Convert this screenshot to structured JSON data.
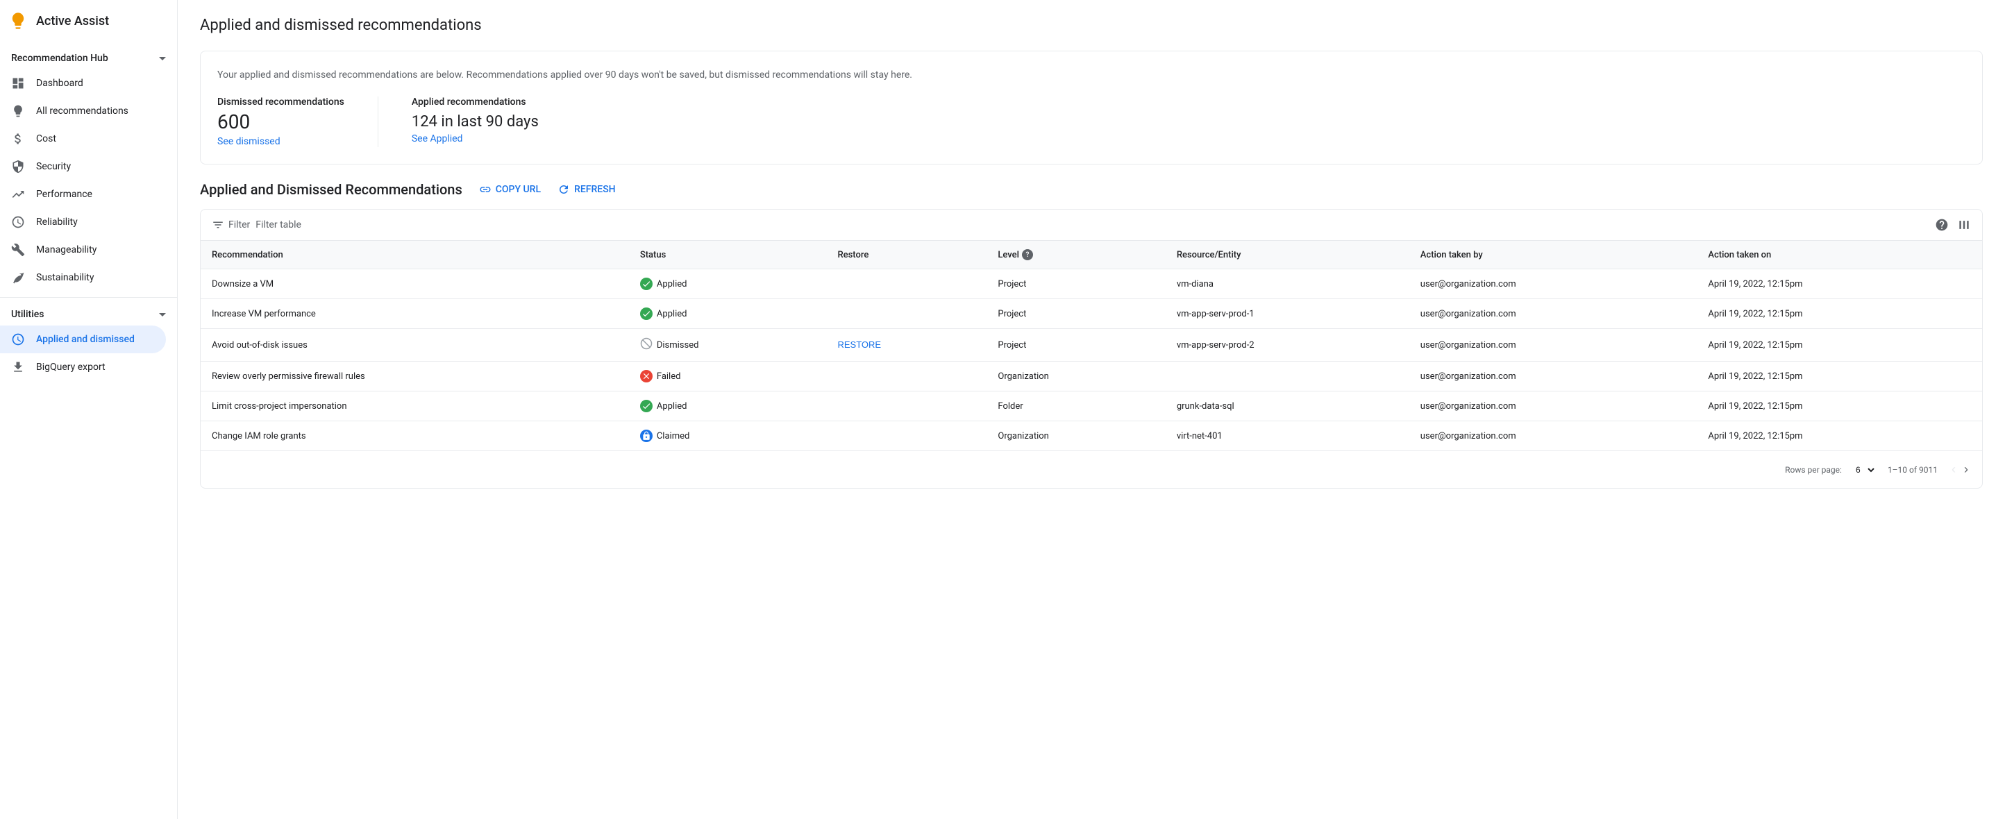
{
  "sidebar": {
    "app_name": "Active Assist",
    "recommendation_hub_label": "Recommendation Hub",
    "items": [
      {
        "id": "dashboard",
        "label": "Dashboard",
        "icon": "dashboard"
      },
      {
        "id": "all-recommendations",
        "label": "All recommendations",
        "icon": "lightbulb"
      },
      {
        "id": "cost",
        "label": "Cost",
        "icon": "dollar"
      },
      {
        "id": "security",
        "label": "Security",
        "icon": "lock"
      },
      {
        "id": "performance",
        "label": "Performance",
        "icon": "trending-up"
      },
      {
        "id": "reliability",
        "label": "Reliability",
        "icon": "clock"
      },
      {
        "id": "manageability",
        "label": "Manageability",
        "icon": "wrench"
      },
      {
        "id": "sustainability",
        "label": "Sustainability",
        "icon": "leaf"
      }
    ],
    "utilities_label": "Utilities",
    "utilities_items": [
      {
        "id": "applied-dismissed",
        "label": "Applied and dismissed",
        "icon": "clock-circle",
        "active": true
      },
      {
        "id": "bigquery-export",
        "label": "BigQuery export",
        "icon": "upload"
      }
    ]
  },
  "main": {
    "page_title": "Applied and dismissed recommendations",
    "info_card": {
      "description": "Your applied and dismissed recommendations are below. Recommendations applied over 90 days won't be saved, but dismissed recommendations will stay here.",
      "dismissed_label": "Dismissed recommendations",
      "dismissed_count": "600",
      "dismissed_link": "See dismissed",
      "applied_label": "Applied recommendations",
      "applied_count": "124 in last 90 days",
      "applied_link": "See Applied"
    },
    "section_title": "Applied and Dismissed Recommendations",
    "copy_url_label": "COPY URL",
    "refresh_label": "REFRESH",
    "filter_placeholder": "Filter table",
    "table": {
      "columns": [
        {
          "id": "recommendation",
          "label": "Recommendation"
        },
        {
          "id": "status",
          "label": "Status"
        },
        {
          "id": "restore",
          "label": "Restore"
        },
        {
          "id": "level",
          "label": "Level"
        },
        {
          "id": "resource",
          "label": "Resource/Entity"
        },
        {
          "id": "action_by",
          "label": "Action taken by"
        },
        {
          "id": "action_on",
          "label": "Action taken on"
        }
      ],
      "rows": [
        {
          "recommendation": "Downsize a VM",
          "status": "Applied",
          "status_type": "applied",
          "restore": "",
          "level": "Project",
          "resource": "vm-diana",
          "action_by": "user@organization.com",
          "action_on": "April 19, 2022, 12:15pm"
        },
        {
          "recommendation": "Increase VM performance",
          "status": "Applied",
          "status_type": "applied",
          "restore": "",
          "level": "Project",
          "resource": "vm-app-serv-prod-1",
          "action_by": "user@organization.com",
          "action_on": "April 19, 2022, 12:15pm"
        },
        {
          "recommendation": "Avoid out-of-disk issues",
          "status": "Dismissed",
          "status_type": "dismissed",
          "restore": "RESTORE",
          "level": "Project",
          "resource": "vm-app-serv-prod-2",
          "action_by": "user@organization.com",
          "action_on": "April 19, 2022, 12:15pm"
        },
        {
          "recommendation": "Review overly permissive firewall rules",
          "status": "Failed",
          "status_type": "failed",
          "restore": "",
          "level": "Organization",
          "resource": "",
          "action_by": "user@organization.com",
          "action_on": "April 19, 2022, 12:15pm"
        },
        {
          "recommendation": "Limit cross-project impersonation",
          "status": "Applied",
          "status_type": "applied",
          "restore": "",
          "level": "Folder",
          "resource": "grunk-data-sql",
          "action_by": "user@organization.com",
          "action_on": "April 19, 2022, 12:15pm"
        },
        {
          "recommendation": "Change IAM role grants",
          "status": "Claimed",
          "status_type": "claimed",
          "restore": "",
          "level": "Organization",
          "resource": "virt-net-401",
          "action_by": "user@organization.com",
          "action_on": "April 19, 2022, 12:15pm"
        }
      ]
    },
    "pagination": {
      "rows_per_page_label": "Rows per page:",
      "rows_per_page_value": "6",
      "range": "1–10 of 9011"
    }
  }
}
